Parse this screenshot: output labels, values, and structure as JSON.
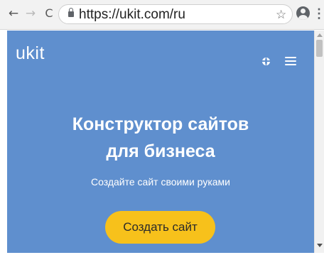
{
  "browser": {
    "url": "https://ukit.com/ru",
    "icons": {
      "back": "back-arrow-icon",
      "forward": "forward-arrow-icon",
      "reload": "reload-icon",
      "lock": "lock-icon",
      "bookmark": "star-icon",
      "account": "account-icon",
      "menu": "kebab-menu-icon"
    },
    "glyphs": {
      "back": "←",
      "forward": "→",
      "reload": "C",
      "bookmark": "☆",
      "menu": "⋮"
    }
  },
  "page": {
    "logo": "ukit",
    "header_icons": {
      "language": "globe-icon",
      "menu": "hamburger-icon"
    },
    "hero": {
      "title_line1": "Конструктор сайтов",
      "title_line2": "для бизнеса",
      "subtitle": "Создайте сайт своими руками",
      "cta_label": "Создать сайт"
    }
  },
  "colors": {
    "page_background": "#5f8fce",
    "cta_background": "#f7c11b",
    "text_primary": "#ffffff",
    "toolbar_background": "#f2f2f2"
  }
}
